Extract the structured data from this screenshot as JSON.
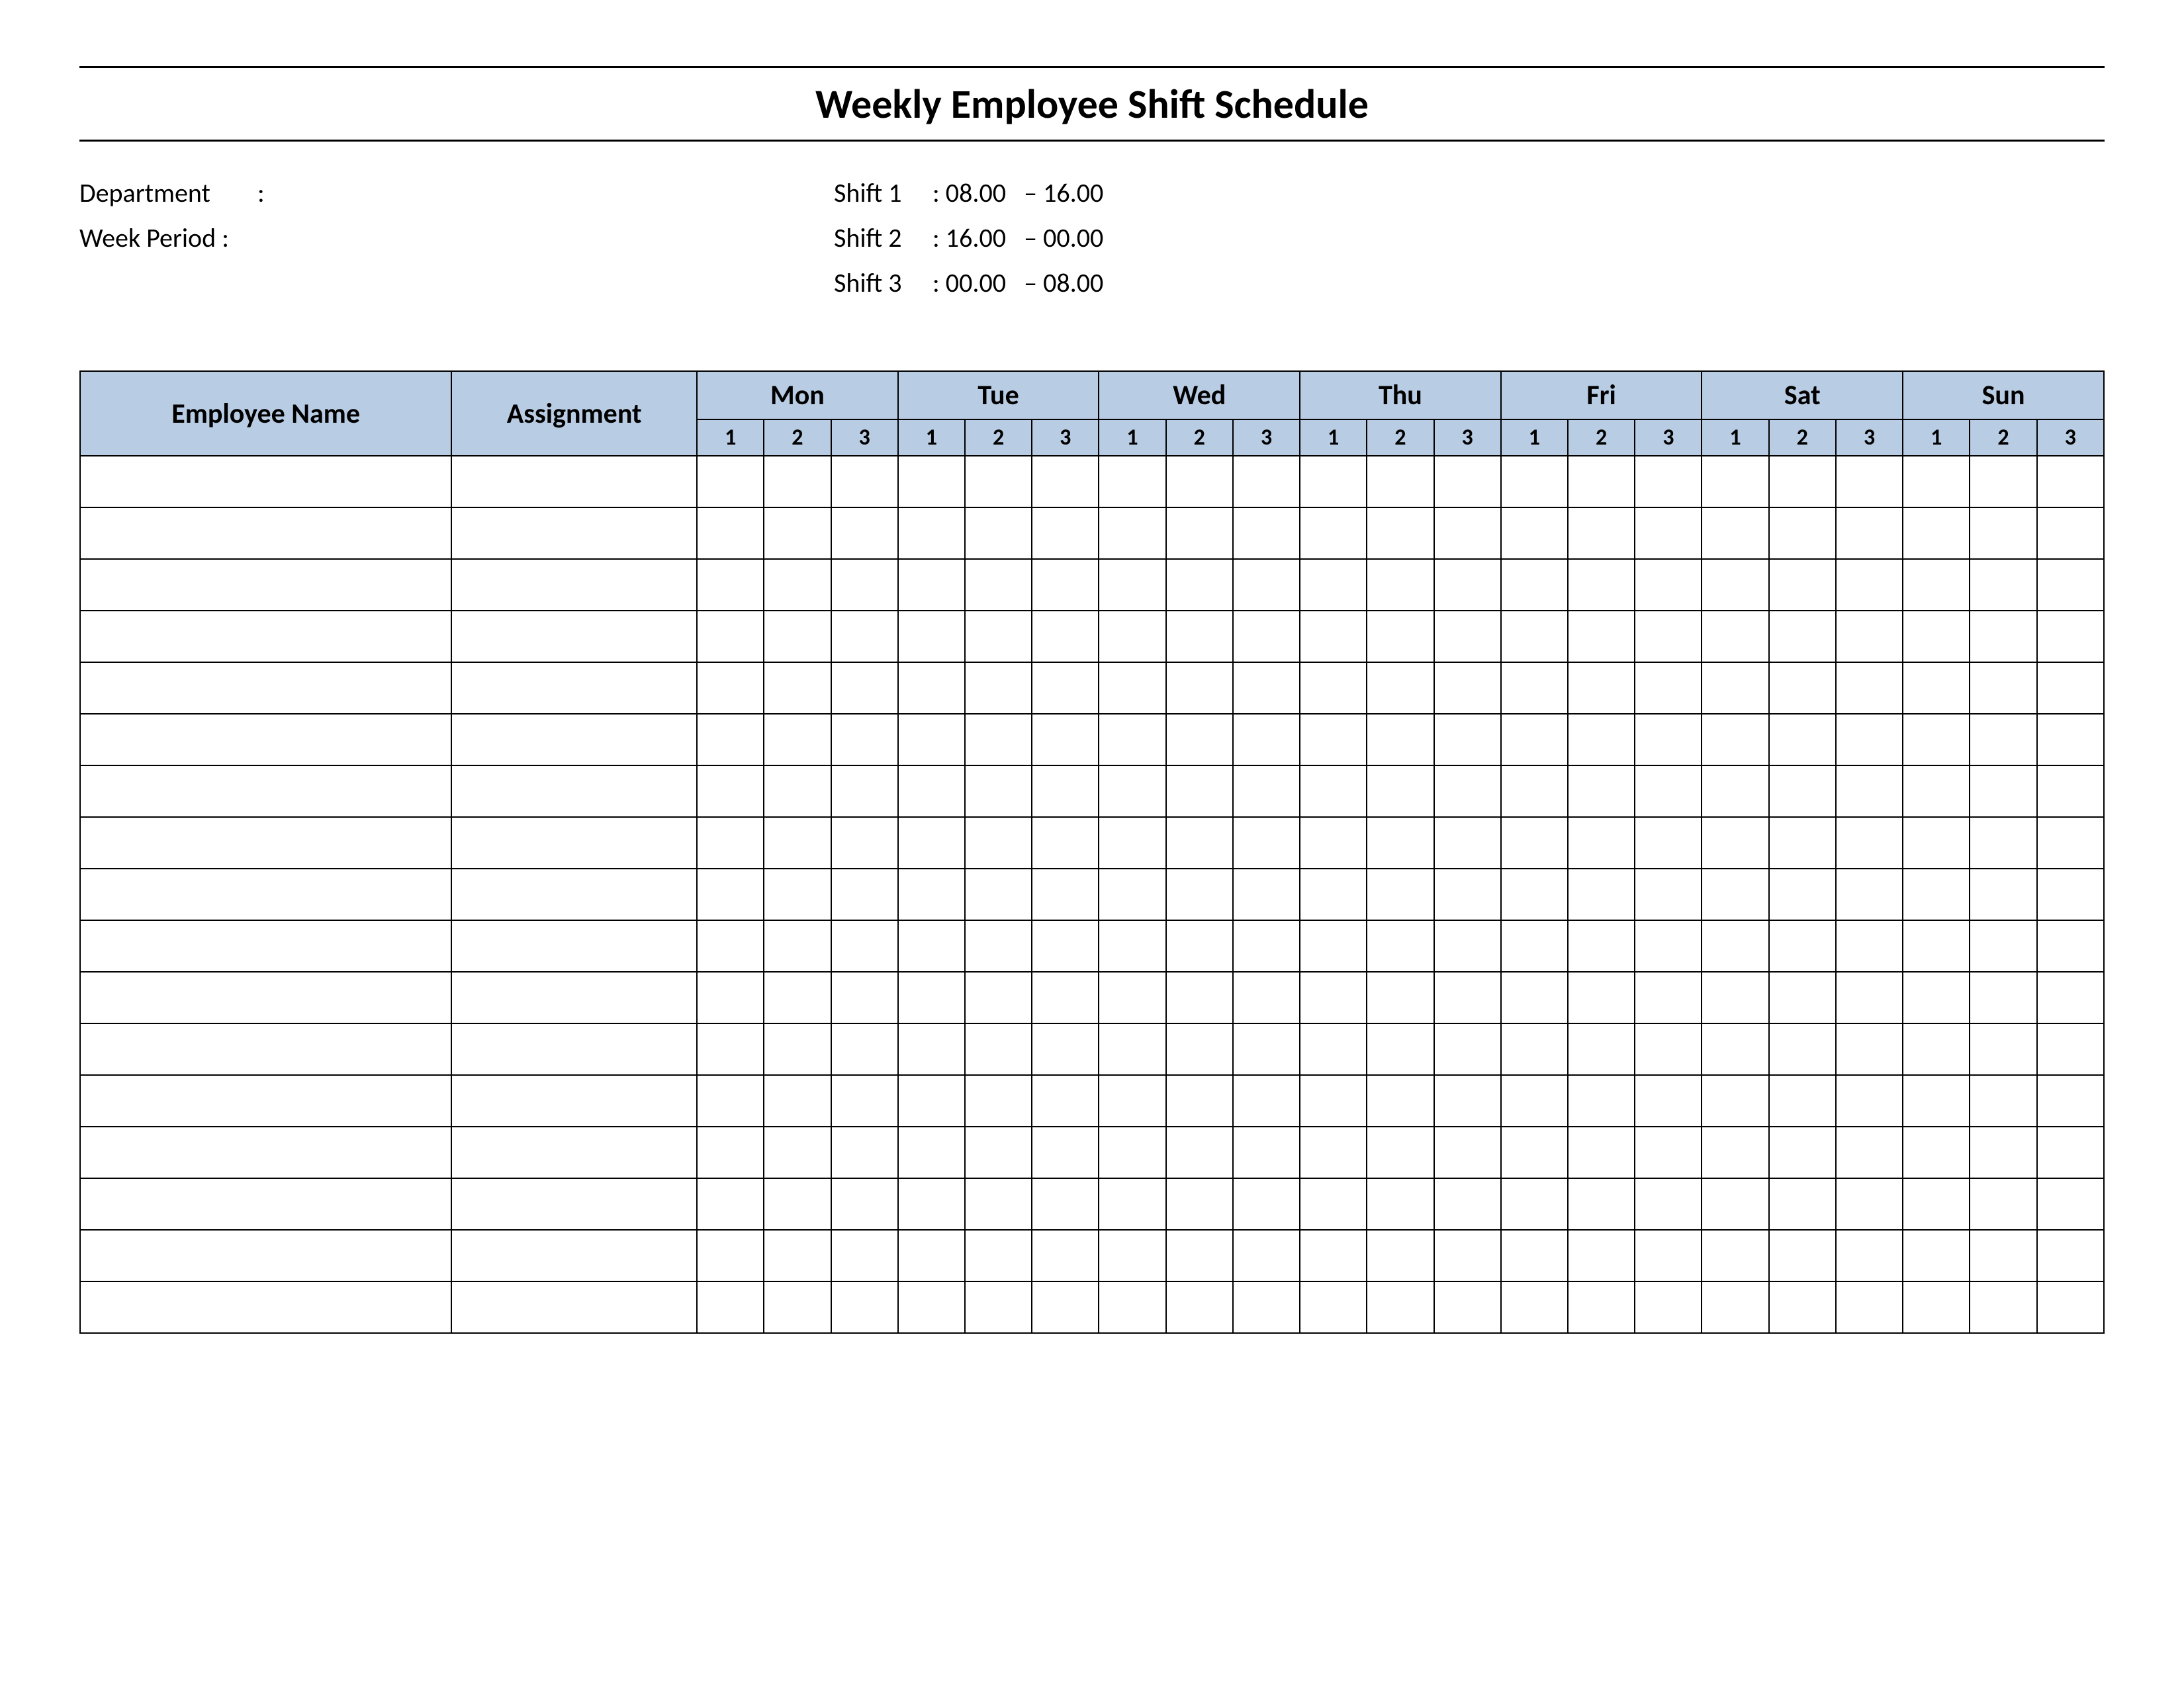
{
  "title": "Weekly Employee Shift Schedule",
  "meta": {
    "department_label": "Department",
    "department_value": "",
    "week_period_label": "Week  Period :",
    "week_period_value": "",
    "sep": ":"
  },
  "shifts": [
    {
      "label": "Shift 1",
      "sep": ":",
      "start": "08.00",
      "dash": "–",
      "end": "16.00"
    },
    {
      "label": "Shift 2",
      "sep": ":",
      "start": "16.00",
      "dash": "–",
      "end": "00.00"
    },
    {
      "label": "Shift 3",
      "sep": ":",
      "start": "00.00",
      "dash": "–",
      "end": "08.00"
    }
  ],
  "table": {
    "headers": {
      "employee_name": "Employee Name",
      "assignment": "Assignment",
      "days": [
        "Mon",
        "Tue",
        "Wed",
        "Thu",
        "Fri",
        "Sat",
        "Sun"
      ],
      "shift_numbers": [
        "1",
        "2",
        "3"
      ]
    },
    "row_count": 17
  }
}
